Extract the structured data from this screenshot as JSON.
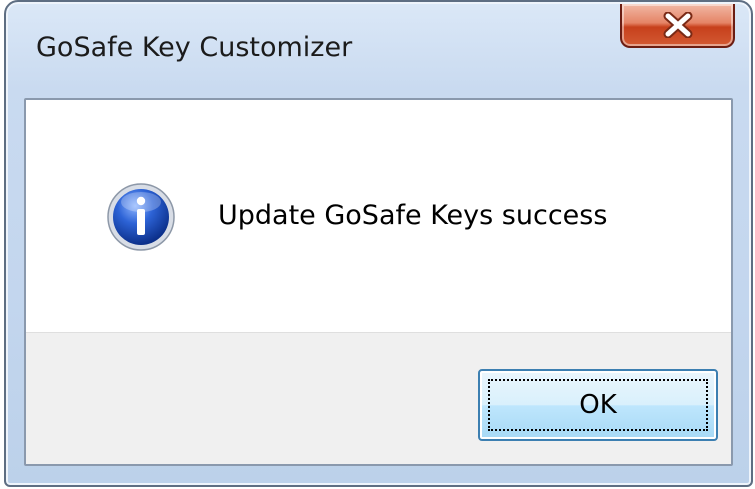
{
  "dialog": {
    "title": "GoSafe Key Customizer",
    "message": "Update GoSafe Keys success",
    "icon": "info-icon",
    "ok_label": "OK",
    "close_icon": "close-icon"
  },
  "colors": {
    "frame": "#c3d6ee",
    "close_button": "#c7401c",
    "button_area": "#f0f0f0",
    "ok_button_border": "#3c7fb1",
    "info_icon_blue": "#1f4fb8"
  }
}
